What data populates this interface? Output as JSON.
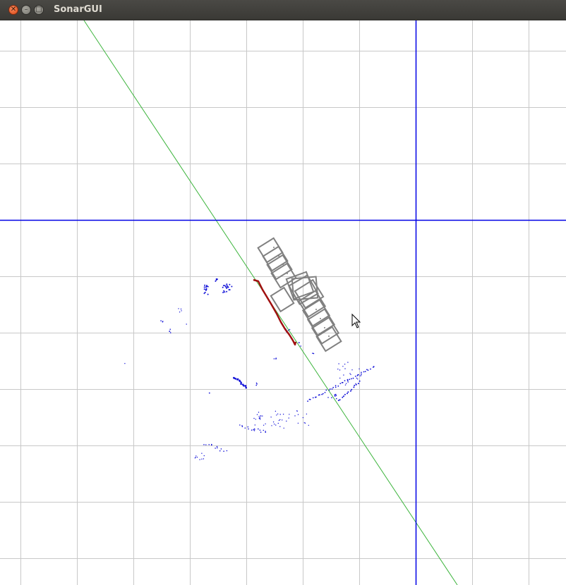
{
  "window": {
    "title": "SonarGUI",
    "close_icon": "close-icon",
    "minimize_icon": "minimize-icon",
    "maximize_icon": "maximize-icon"
  },
  "colors": {
    "grid": "#c8c8c8",
    "axis": "#0000e6",
    "heading_line": "#3cb43c",
    "robot_trail": "#808080",
    "sonar_points": "#1414d8",
    "wall_segment": "#a01010",
    "background": "#ffffff"
  },
  "cursor": "arrow-cursor-icon"
}
